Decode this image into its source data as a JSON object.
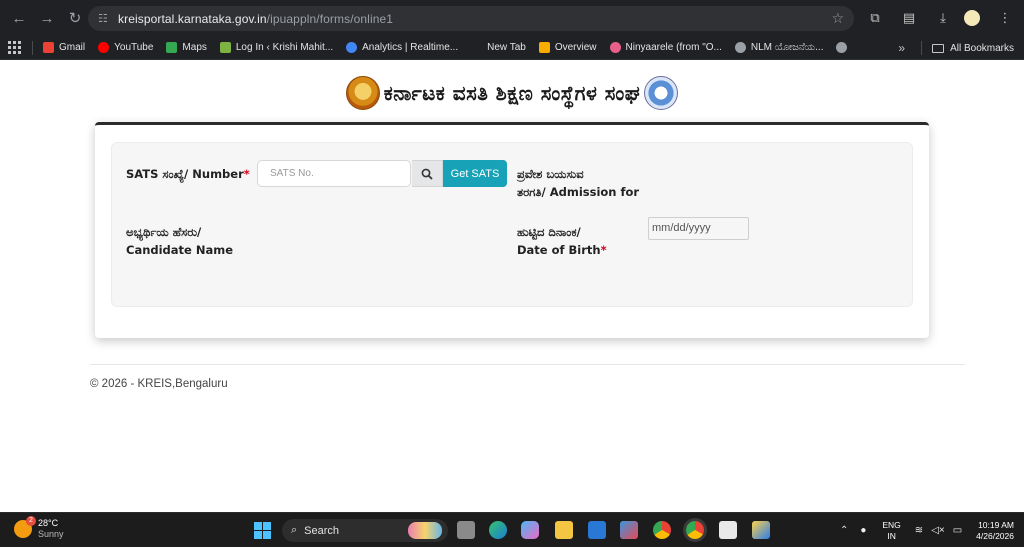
{
  "browser": {
    "url_domain": "kreisportal.karnataka.gov.in",
    "url_path": "/ipuappln/forms/online1",
    "bookmarks": [
      {
        "label": "Gmail",
        "color": "#ea4335"
      },
      {
        "label": "YouTube",
        "color": "#ff0000"
      },
      {
        "label": "Maps",
        "color": "#34a853"
      },
      {
        "label": "Log In ‹ Krishi Mahit...",
        "color": "#7cb342"
      },
      {
        "label": "Analytics | Realtime...",
        "color": "#4285f4"
      },
      {
        "label": "New Tab",
        "color": "#202124"
      },
      {
        "label": "Overview",
        "color": "#f9ab00"
      },
      {
        "label": "Ninyaarele (from \"O...",
        "color": "#e8608a"
      },
      {
        "label": "NLM ಯೋಜನೆಯ...",
        "color": "#9aa0a6"
      }
    ],
    "all_bookmarks_label": "All Bookmarks"
  },
  "page": {
    "org_title": "ಕರ್ನಾಟಕ ವಸತಿ ಶಿಕ್ಷಣ ಸಂಸ್ಥೆಗಳ ಸಂಘ",
    "form": {
      "sats_label_kn": "SATS ಸಂಖ್ಯೆ/",
      "sats_label_en": "Number",
      "sats_required": "*",
      "sats_placeholder": "SATS No.",
      "get_sats_label": "Get SATS",
      "admission_label_kn_line1": "ಪ್ರವೇಶ ಬಯಸುವ",
      "admission_label_kn_line2": "ತರಗತಿ/",
      "admission_label_en": "Admission for",
      "candidate_label_kn": "ಅಭ್ಯರ್ಥಿಯ ಹೆಸರು/",
      "candidate_label_en": "Candidate Name",
      "dob_label_kn": "ಹುಟ್ಟಿದ ದಿನಾಂಕ/",
      "dob_label_en": "Date of Birth",
      "dob_required": "*",
      "dob_placeholder": "mm/dd/yyyy"
    },
    "footer_text": "© 2026 - KREIS,Bengaluru"
  },
  "taskbar": {
    "temperature": "28°C",
    "condition": "Sunny",
    "weather_badge": "2",
    "search_label": "Search",
    "lang_line1": "ENG",
    "lang_line2": "IN",
    "time": "10:19 AM",
    "date": "4/26/2026"
  }
}
